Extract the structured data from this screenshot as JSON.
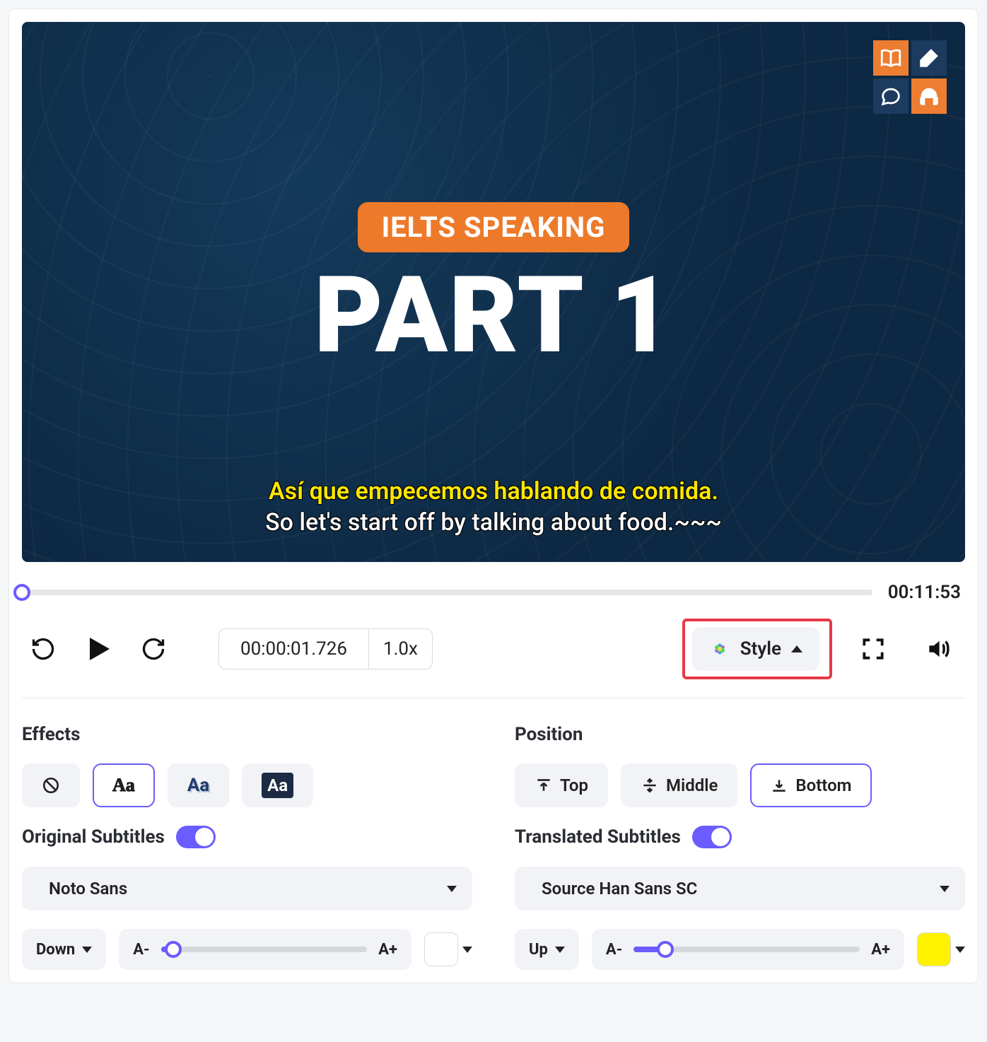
{
  "video": {
    "pill": "IELTS SPEAKING",
    "big": "PART 1",
    "subtitle_translated": "Así que empecemos hablando de comida.",
    "subtitle_original": "So let's start off by talking about food.~~~"
  },
  "player": {
    "duration": "00:11:53",
    "current_time": "00:00:01.726",
    "speed": "1.0x",
    "style_label": "Style"
  },
  "effects": {
    "title": "Effects",
    "options": [
      "none",
      "outline",
      "shadow",
      "box"
    ],
    "selected": "outline"
  },
  "position": {
    "title": "Position",
    "options": {
      "top": "Top",
      "middle": "Middle",
      "bottom": "Bottom"
    },
    "selected": "bottom"
  },
  "original": {
    "title": "Original Subtitles",
    "enabled": true,
    "font": "Noto Sans",
    "layer": "Down",
    "size_minus": "A-",
    "size_plus": "A+",
    "slider_pct": 6,
    "color": "#ffffff"
  },
  "translated": {
    "title": "Translated Subtitles",
    "enabled": true,
    "font": "Source Han Sans SC",
    "layer": "Up",
    "size_minus": "A-",
    "size_plus": "A+",
    "slider_pct": 14,
    "color": "#fff200"
  }
}
